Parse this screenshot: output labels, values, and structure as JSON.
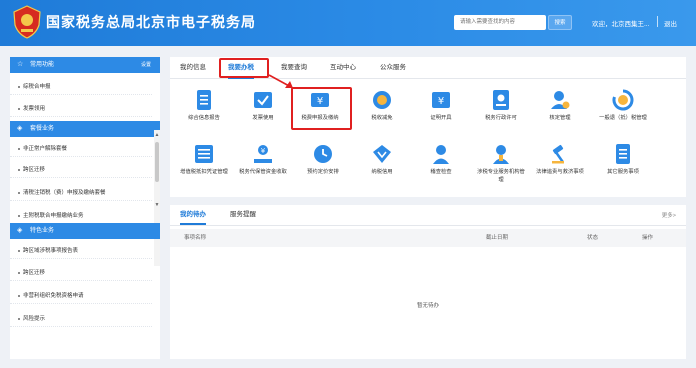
{
  "header": {
    "title": "国家税务总局北京市电子税务局",
    "search_placeholder": "请输入需要查找的内容",
    "search_button": "搜索",
    "welcome": "欢迎，北京西集王...",
    "logout": "退出",
    "brand_color": "#1f7bd8"
  },
  "sidebar": {
    "sections": [
      {
        "title": "常用功能",
        "icon": "star-icon",
        "extra": "设置"
      },
      {
        "title": "套餐业务",
        "icon": "cube-icon"
      },
      {
        "title": "特色业务",
        "icon": "cube-icon"
      }
    ],
    "common_items": [
      "综税合申报",
      "发票领用"
    ],
    "package_items": [
      "非正常户解除套餐",
      "跨区迁移",
      "清税注销税（费）申报及缴纳套餐",
      "主附税联合申报缴纳业务"
    ],
    "special_items": [
      "跨区域涉税事项报告表",
      "跨区迁移",
      "非营利组织免税资格申请",
      "风险提示"
    ]
  },
  "main": {
    "tabs": [
      "我的信息",
      "我要办税",
      "我要查询",
      "互动中心",
      "公众服务"
    ],
    "active_tab": "我要办税",
    "functions_row1": [
      "综合信息报告",
      "发票使用",
      "税费申报及缴纳",
      "税收减免",
      "证明开具",
      "税务行政许可",
      "核定管理",
      "一般退（抵）税管理"
    ],
    "functions_row2": [
      "增值税抵扣凭证管理",
      "税务代保管资金收取",
      "预约定价安排",
      "纳税信用",
      "稽查检查",
      "涉税专业服务机构管理",
      "法律追责与救济事项",
      "其它服务事项"
    ]
  },
  "todo": {
    "tabs": [
      "我的待办",
      "服务提醒"
    ],
    "more": "更多>",
    "columns": [
      "事项名称",
      "截止日期",
      "状态",
      "操作"
    ],
    "empty_text": "暂无待办"
  },
  "highlight_color": "#e02020"
}
